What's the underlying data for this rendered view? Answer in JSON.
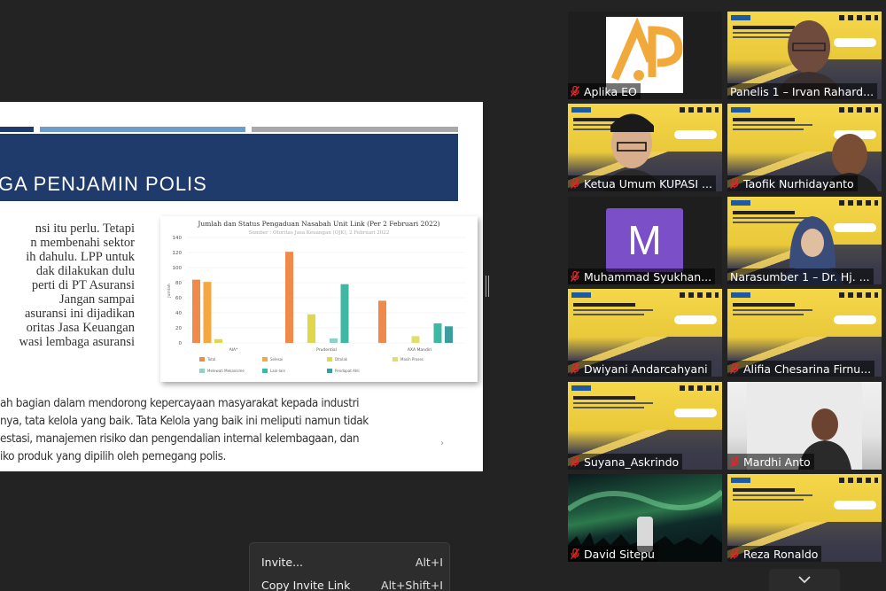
{
  "slide": {
    "title": "GA PENJAMIN POLIS",
    "body_lines": [
      "nsi itu perlu. Tetapi",
      "n membenahi sektor",
      "ih dahulu. LPP untuk",
      "dak dilakukan dulu",
      "perti di PT Asuransi",
      "Jangan sampai",
      "asuransi ini dijadikan",
      "oritas Jasa Keuangan",
      "wasi lembaga asuransi"
    ],
    "bottom_lines": [
      "ah bagian dalam mendorong kepercayaan masyarakat kepada industri",
      "nya, tata kelola yang baik. Tata Kelola yang baik ini meliputi namun tidak",
      "estasi, manajemen risiko dan pengendalian internal kelembagaan, dan",
      "iko produk yang dipilih oleh pemegang polis."
    ],
    "bar_colors": [
      "#1f3b6c",
      "#6f9bc9",
      "#a8a8a8"
    ],
    "banner_color": "#1f3b6c"
  },
  "chart_data": {
    "type": "bar",
    "title": "Jumlah dan Status Pengaduan Nasabah Unit Link (Per 2 Februari 2022)",
    "subtitle": "Sumber : Otoritas Jasa Keuangan (OJK), 2 Februari 2022",
    "ylabel": "Jumlah",
    "ylim": [
      0,
      140
    ],
    "yticks": [
      0,
      20,
      40,
      60,
      80,
      100,
      120,
      140
    ],
    "categories": [
      "AIA*",
      "Prudential",
      "AXA Mandiri"
    ],
    "series": [
      {
        "name": "Total",
        "color": "#f08a4b",
        "values": [
          84,
          121,
          56
        ]
      },
      {
        "name": "Selesai",
        "color": "#f5a742",
        "values": [
          81,
          0,
          0
        ]
      },
      {
        "name": "Ditolak",
        "color": "#e0d84a",
        "values": [
          5,
          38,
          0
        ]
      },
      {
        "name": "Masih Proses",
        "color": "#dfe06a",
        "values": [
          0,
          0,
          9
        ]
      },
      {
        "name": "Melewati Mekanisme",
        "color": "#8fd0c8",
        "values": [
          0,
          6,
          0
        ]
      },
      {
        "name": "Lain-lain",
        "color": "#3fb8a3",
        "values": [
          0,
          78,
          26
        ]
      },
      {
        "name": "Pendapat Ahli",
        "color": "#3a9ea0",
        "values": [
          0,
          0,
          22
        ]
      }
    ],
    "legend_position": "bottom",
    "grid": true
  },
  "participants": [
    {
      "name": "Aplika EO",
      "muted": true,
      "kind": "logo"
    },
    {
      "name": "Panelis 1 – Irvan Rahard...",
      "muted": false,
      "kind": "video-webinar"
    },
    {
      "name": "Ketua Umum KUPASI ...",
      "muted": true,
      "kind": "video-webinar"
    },
    {
      "name": "Taofik Nurhidayanto",
      "muted": true,
      "kind": "video-webinar"
    },
    {
      "name": "Muhammad Syukhan...",
      "muted": true,
      "kind": "avatar",
      "initial": "M",
      "avatar_color": "#7b4fc7"
    },
    {
      "name": "Narasumber 1 – Dr. Hj. ...",
      "muted": false,
      "kind": "video-webinar",
      "active_speaker": true
    },
    {
      "name": "Dwiyani Andarcahyani",
      "muted": true,
      "kind": "webinar"
    },
    {
      "name": "Alifia Chesarina Firnu...",
      "muted": true,
      "kind": "webinar"
    },
    {
      "name": "Suyana_Askrindo",
      "muted": true,
      "kind": "webinar"
    },
    {
      "name": "Mardhi Anto",
      "muted": true,
      "kind": "video-room"
    },
    {
      "name": "David Sitepu",
      "muted": true,
      "kind": "aurora"
    },
    {
      "name": "Reza Ronaldo",
      "muted": true,
      "kind": "webinar"
    }
  ],
  "context_menu": {
    "items": [
      {
        "label": "Invite...",
        "shortcut": "Alt+I"
      },
      {
        "label": "Copy Invite Link",
        "shortcut": "Alt+Shift+I"
      }
    ]
  },
  "icons": {
    "muted": "mic-muted-icon",
    "scroll": "chevron-down-icon"
  },
  "accent": {
    "muted_red": "#e02828",
    "active_speaker_border": "#c8d93a"
  }
}
